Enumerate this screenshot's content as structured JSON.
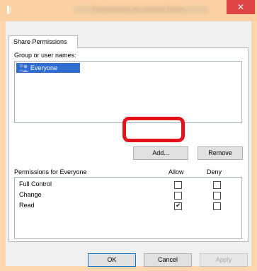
{
  "window": {
    "title": "Permissions for shared folder",
    "close_glyph": "✕"
  },
  "tab": {
    "label": "Share Permissions"
  },
  "group_section": {
    "label": "Group or user names:",
    "users": [
      "Everyone"
    ]
  },
  "buttons": {
    "add": "Add...",
    "remove": "Remove",
    "ok": "OK",
    "cancel": "Cancel",
    "apply": "Apply"
  },
  "permissions_section": {
    "label": "Permissions for Everyone",
    "allow_header": "Allow",
    "deny_header": "Deny",
    "rows": [
      {
        "name": "Full Control",
        "allow": false,
        "deny": false
      },
      {
        "name": "Change",
        "allow": false,
        "deny": false
      },
      {
        "name": "Read",
        "allow": true,
        "deny": false
      }
    ]
  },
  "icons": {
    "app": "folder-share-icon",
    "users": "users-icon",
    "close": "close-icon"
  },
  "colors": {
    "titlebar": "#fbd1a4",
    "close_button": "#e04343",
    "selection": "#2f6dd0",
    "highlight": "#e3121c"
  }
}
